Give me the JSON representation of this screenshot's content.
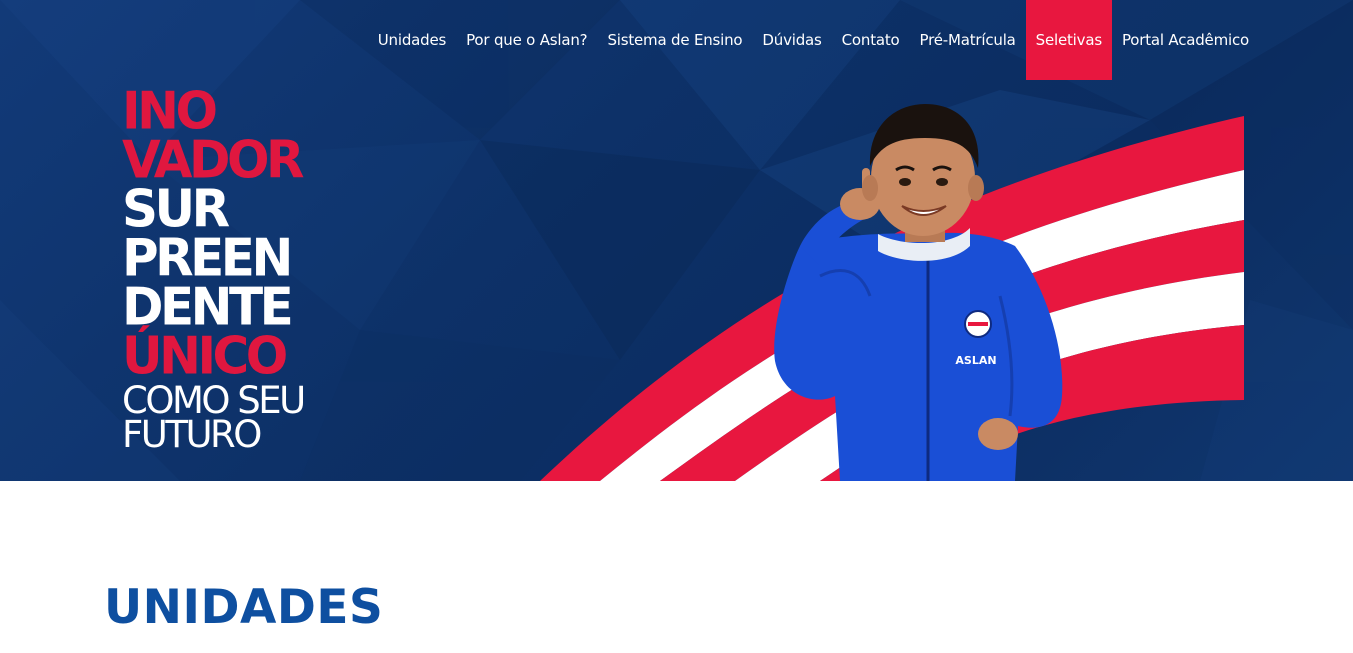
{
  "nav": {
    "items": [
      {
        "label": "Unidades"
      },
      {
        "label": "Por que o Aslan?"
      },
      {
        "label": "Sistema de Ensino"
      },
      {
        "label": "Dúvidas"
      },
      {
        "label": "Contato"
      },
      {
        "label": "Pré-Matrícula"
      },
      {
        "label": "Seletivas",
        "active": true
      },
      {
        "label": "Portal Acadêmico"
      }
    ]
  },
  "hero": {
    "slogan": {
      "line1": "INO",
      "line2": "VADOR",
      "line3": "SUR",
      "line4": "PREEN",
      "line5": "DENTE",
      "line6": "ÚNICO",
      "line7": "COMO SEU",
      "line8": "FUTURO"
    },
    "jacket_logo": "ASLAN",
    "colors": {
      "brand_red": "#e8173f",
      "brand_blue": "#0d3168",
      "jacket_blue": "#1a4fd6"
    }
  },
  "section": {
    "title": "UNIDADES"
  }
}
